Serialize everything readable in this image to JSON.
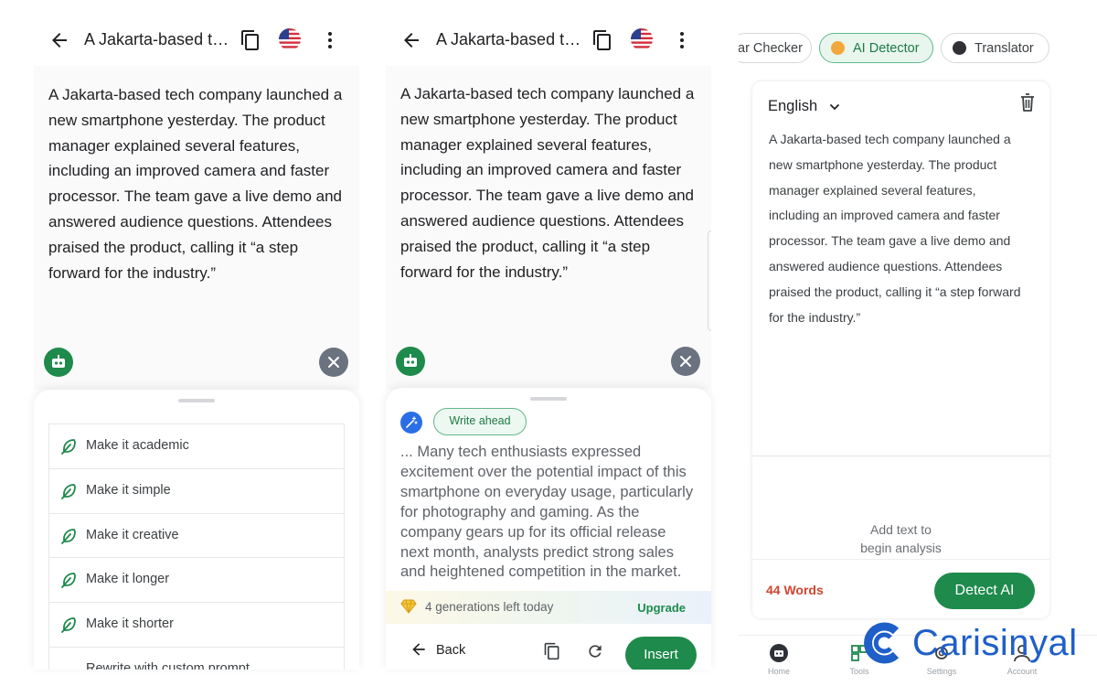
{
  "panel_left": {
    "title": "A Jakarta-based te...",
    "body_text": "A Jakarta-based tech company launched a new smartphone yesterday. The product manager explained several features, including an improved camera and faster processor. The team gave a live demo and answered audience questions. Attendees praised the product, calling it “a step forward for the industry.”",
    "options": [
      "Make it academic",
      "Make it simple",
      "Make it creative",
      "Make it longer",
      "Make it shorter",
      "Rewrite with custom prompt"
    ]
  },
  "panel_middle": {
    "title": "A Jakarta-based te...",
    "body_text": "A Jakarta-based tech company launched a new smartphone yesterday. The product manager explained several features, including an improved camera and faster processor. The team gave a live demo and answered audience questions. Attendees praised the product, calling it “a step forward for the industry.”",
    "write_ahead_label": "Write ahead",
    "generated_text": "... Many tech enthusiasts expressed excitement over the potential impact of this smartphone on everyday usage, particularly for photography and gaming. As the company gears up for its official release next month, analysts predict strong sales and heightened competition in the market.",
    "generations_left": "4 generations left today",
    "upgrade_label": "Upgrade",
    "back_label": "Back",
    "insert_label": "Insert"
  },
  "panel_right": {
    "tabs": [
      {
        "label": "ar Checker",
        "active": false
      },
      {
        "label": "AI Detector",
        "active": true
      },
      {
        "label": "Translator",
        "active": false
      }
    ],
    "language": "English",
    "body_text": "A Jakarta-based tech company launched a new smartphone yesterday. The product manager explained several features, including an improved camera and faster processor. The team gave a live demo and answered audience questions. Attendees praised the product, calling it “a step forward for the industry.”",
    "hint_line1": "Add text to",
    "hint_line2": "begin analysis",
    "word_count": "44 Words",
    "detect_label": "Detect AI",
    "nav": [
      "Home",
      "Tools",
      "Settings",
      "Account"
    ]
  },
  "watermark": "Carisinyal",
  "colors": {
    "brand_green": "#1e8a4c",
    "chip_green_bg": "#e9f6ee",
    "word_count_red": "#d0452f",
    "write_ahead_blue": "#2b6fe7",
    "watermark_blue": "#1f5fc8"
  },
  "icons": {
    "back": "arrow-left-icon",
    "copy": "copy-icon",
    "flag": "us-flag-icon",
    "more": "more-vertical-icon",
    "assistant": "robot-icon",
    "close": "close-icon",
    "option": "feather-icon",
    "write_ahead": "magic-wand-icon",
    "premium": "diamond-icon",
    "refresh": "refresh-icon",
    "delete": "trash-icon",
    "dropdown": "chevron-down-icon"
  }
}
